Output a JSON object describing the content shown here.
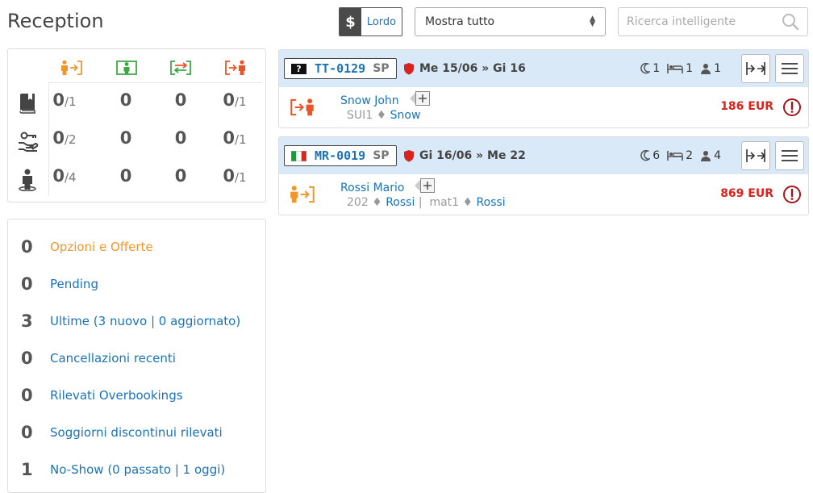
{
  "header": {
    "title": "Reception",
    "price_toggle_symbol": "$",
    "price_toggle_label": "Lordo",
    "filter_value": "Mostra tutto",
    "search_placeholder": "Ricerca intelligente"
  },
  "colors": {
    "accent_blue": "#1a73b8",
    "arrival": "#f0962d",
    "inhouse": "#3ca845",
    "change": "#3ca845",
    "departure": "#e8552a",
    "price": "#d9231d"
  },
  "stats": {
    "columns": [
      "arrival-icon",
      "in-house-icon",
      "room-change-icon",
      "departure-icon"
    ],
    "rows": [
      {
        "icon": "book-icon",
        "cells": [
          {
            "v": "0",
            "d": "/1"
          },
          {
            "v": "0",
            "d": ""
          },
          {
            "v": "0",
            "d": ""
          },
          {
            "v": "0",
            "d": "/1"
          }
        ]
      },
      {
        "icon": "key-hand-icon",
        "cells": [
          {
            "v": "0",
            "d": "/2"
          },
          {
            "v": "0",
            "d": ""
          },
          {
            "v": "0",
            "d": ""
          },
          {
            "v": "0",
            "d": "/1"
          }
        ]
      },
      {
        "icon": "guest-icon",
        "cells": [
          {
            "v": "0",
            "d": "/4"
          },
          {
            "v": "0",
            "d": ""
          },
          {
            "v": "0",
            "d": ""
          },
          {
            "v": "0",
            "d": "/1"
          }
        ]
      }
    ]
  },
  "shortcuts": [
    {
      "count": "0",
      "label": "Opzioni e Offerte"
    },
    {
      "count": "0",
      "label": "Pending"
    },
    {
      "count": "3",
      "label": "Ultime (3 nuovo | 0 aggiornato)"
    },
    {
      "count": "0",
      "label": "Cancellazioni recenti"
    },
    {
      "count": "0",
      "label": "Rilevati Overbookings"
    },
    {
      "count": "0",
      "label": "Soggiorni discontinui rilevati"
    },
    {
      "count": "1",
      "label": "No-Show (0 passato | 1 oggi)"
    }
  ],
  "reservations": [
    {
      "flag": "unknown-flag-icon",
      "flag_text": "?",
      "code": "TT-0129",
      "channel": "SP",
      "dates": "Me 15/06 » Gi 16",
      "nights": "1",
      "rooms": "1",
      "guests": "1",
      "status_icon": "departure-icon",
      "guest_name": "Snow John",
      "room": "SUI1",
      "sep": "♦",
      "room_guest": "Snow",
      "price": "186 EUR"
    },
    {
      "flag": "italy-flag-icon",
      "code": "MR-0019",
      "channel": "SP",
      "dates": "Gi 16/06 » Me 22",
      "nights": "6",
      "rooms": "2",
      "guests": "4",
      "status_icon": "arrival-icon",
      "guest_name": "Rossi Mario",
      "room": "202",
      "sep": "♦",
      "room_guest": "Rossi",
      "divider": "|",
      "room2": "mat1",
      "room2_guest": "Rossi",
      "price": "869 EUR"
    }
  ]
}
